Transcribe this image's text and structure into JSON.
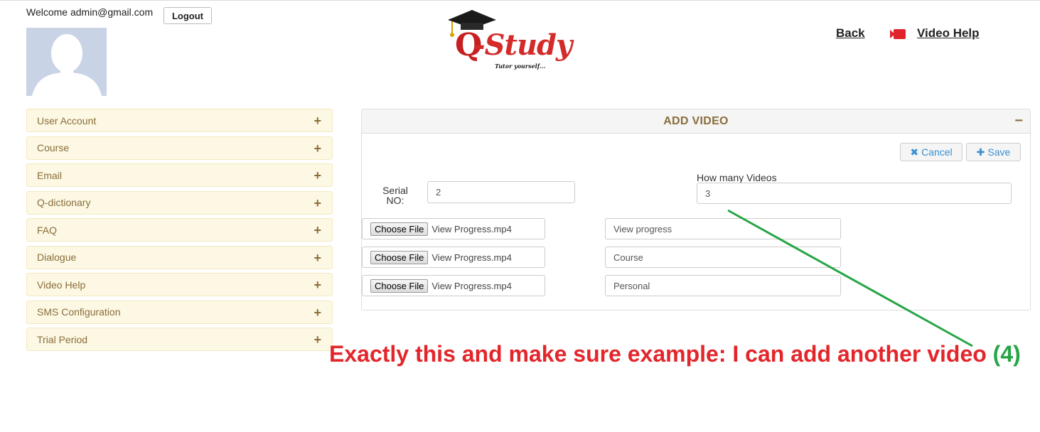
{
  "header": {
    "welcome_text": "Welcome admin@gmail.com",
    "logout_label": "Logout",
    "logo_text": "-Study",
    "logo_letter": "Q",
    "logo_tagline": "Tutor yourself...",
    "back_label": "Back",
    "video_help_label": "Video Help"
  },
  "sidebar": {
    "items": [
      {
        "label": "User Account"
      },
      {
        "label": "Course"
      },
      {
        "label": "Email"
      },
      {
        "label": "Q-dictionary"
      },
      {
        "label": "FAQ"
      },
      {
        "label": "Dialogue"
      },
      {
        "label": "Video Help"
      },
      {
        "label": "SMS Configuration"
      },
      {
        "label": "Trial Period"
      }
    ],
    "expand_symbol": "+"
  },
  "panel": {
    "title": "ADD VIDEO",
    "collapse_symbol": "−",
    "cancel_label": "Cancel",
    "save_label": "Save",
    "serial_label": "Serial NO:",
    "serial_value": "2",
    "how_many_label": "How many Videos",
    "how_many_value": "3",
    "rows": [
      {
        "choose_label": "Choose File",
        "file_name": "View Progress.mp4",
        "title": "View progress"
      },
      {
        "choose_label": "Choose File",
        "file_name": "View Progress.mp4",
        "title": "Course"
      },
      {
        "choose_label": "Choose File",
        "file_name": "View Progress.mp4",
        "title": "Personal"
      }
    ]
  },
  "annotation": {
    "text": "Exactly this and make sure example: I can add another video ",
    "number": "(4)",
    "text_color": "#e3262b",
    "number_color": "#26a545",
    "arrow_color": "#26a545"
  },
  "colors": {
    "sidebar_bg": "#fcf8e3",
    "sidebar_text": "#8a6d3b",
    "button_text": "#3a8fd0",
    "logo_red": "#d42a2a"
  }
}
